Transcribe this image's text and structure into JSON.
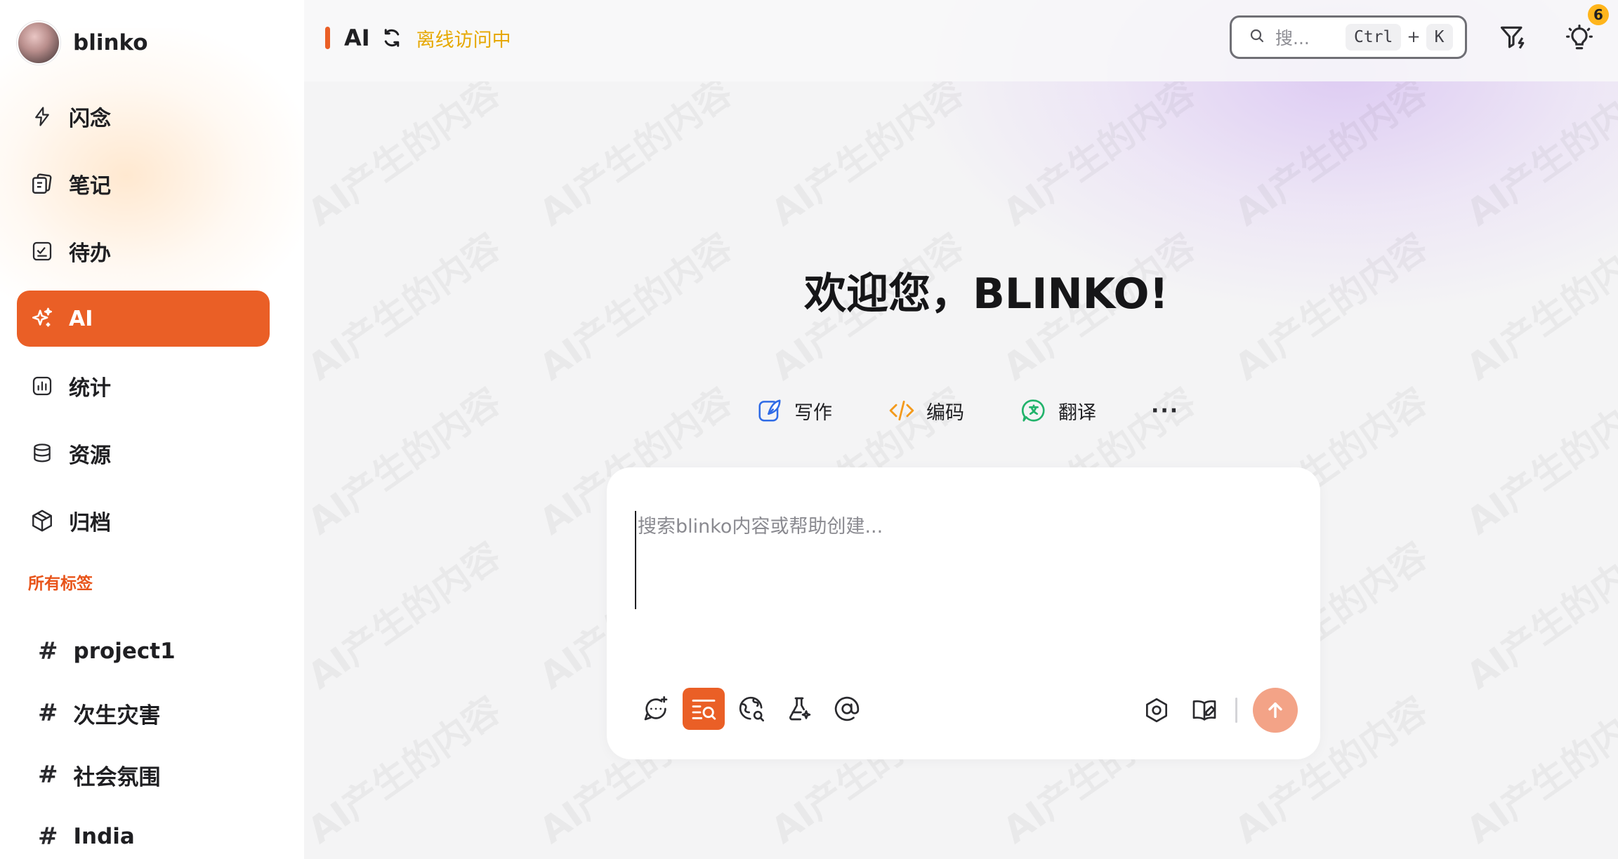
{
  "profile": {
    "name": "blinko"
  },
  "nav": {
    "items": [
      {
        "label": "闪念",
        "icon": "lightning-icon"
      },
      {
        "label": "笔记",
        "icon": "notes-icon"
      },
      {
        "label": "待办",
        "icon": "todo-icon"
      },
      {
        "label": "AI",
        "icon": "sparkle-icon",
        "active": true
      },
      {
        "label": "统计",
        "icon": "chart-icon"
      },
      {
        "label": "资源",
        "icon": "database-icon"
      },
      {
        "label": "归档",
        "icon": "archive-box-icon"
      }
    ]
  },
  "tags": {
    "title": "所有标签",
    "items": [
      {
        "hash": "#",
        "label": "project1"
      },
      {
        "hash": "#",
        "label": "次生灾害"
      },
      {
        "hash": "#",
        "label": "社会氛围"
      },
      {
        "hash": "#",
        "label": "India"
      }
    ]
  },
  "header": {
    "title": "AI",
    "status": "离线访问中",
    "search_placeholder": "搜...",
    "shortcut_ctrl": "Ctrl",
    "shortcut_plus": "+",
    "shortcut_key": "K",
    "notification_count": "6"
  },
  "main": {
    "welcome": "欢迎您，BLINKO!",
    "watermark": "AI产生的内容",
    "quick_actions": [
      {
        "label": "写作",
        "icon": "pen-icon"
      },
      {
        "label": "编码",
        "icon": "code-icon"
      },
      {
        "label": "翻译",
        "icon": "translate-icon"
      }
    ],
    "more_label": "···",
    "chat_placeholder": "搜索blinko内容或帮助创建..."
  },
  "colors": {
    "accent": "#ea5f26",
    "status_yellow": "#e6a800",
    "badge": "#ffb51c",
    "send_button": "#f3a387"
  }
}
